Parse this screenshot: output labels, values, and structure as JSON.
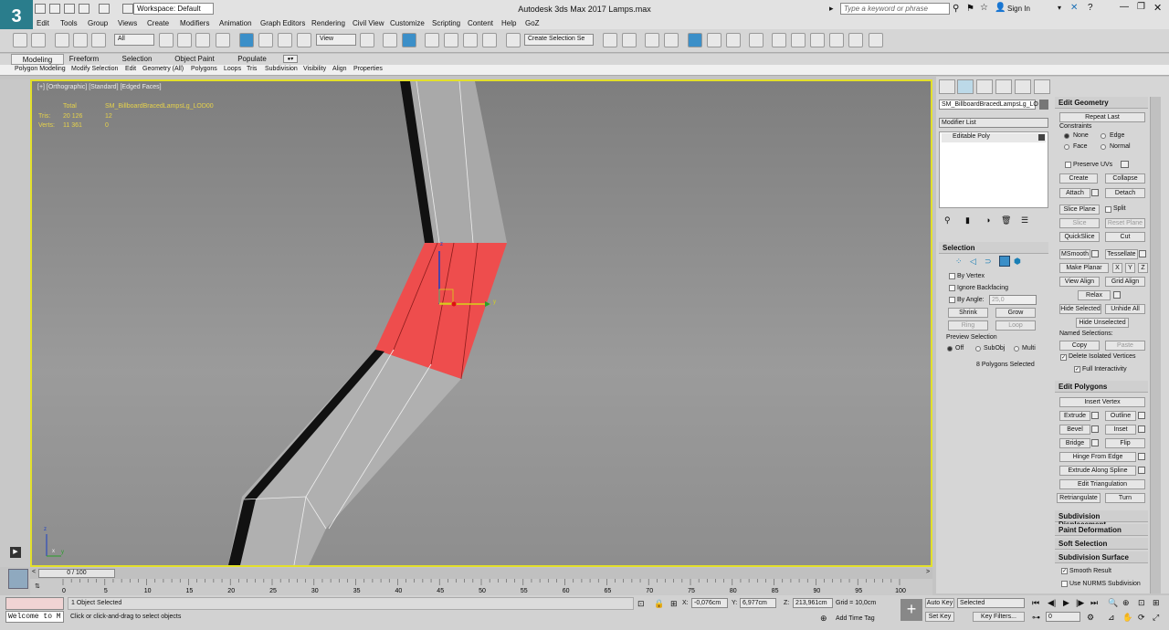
{
  "app": {
    "logo": "3",
    "title": "Autodesk 3ds Max 2017    Lamps.max",
    "workspace": "Workspace: Default",
    "search_placeholder": "Type a keyword or phrase",
    "signin": "Sign In"
  },
  "menu": [
    "Edit",
    "Tools",
    "Group",
    "Views",
    "Create",
    "Modifiers",
    "Animation",
    "Graph Editors",
    "Rendering",
    "Civil View",
    "Customize",
    "Scripting",
    "Content",
    "Help",
    "GoZ"
  ],
  "toolbar": {
    "filter": "All",
    "refcoord": "View",
    "selset": "Create Selection Se"
  },
  "ribbon_tabs": [
    "Modeling",
    "Freeform",
    "Selection",
    "Object Paint",
    "Populate"
  ],
  "ribbon_sub": [
    "Polygon Modeling",
    "Modify Selection",
    "Edit",
    "Geometry (All)",
    "Polygons",
    "Loops",
    "Tris",
    "Subdivision",
    "Visibility",
    "Align",
    "Properties"
  ],
  "viewport": {
    "label": "[+] [Orthographic] [Standard] [Edged Faces]",
    "stats_header_total": "Total",
    "stats_header_obj": "SM_BillboardBracedLampsLg_LOD00",
    "tris_label": "Tris:",
    "tris_total": "20 126",
    "tris_obj": "12",
    "verts_label": "Verts:",
    "verts_total": "11 361",
    "verts_obj": "0",
    "gizmo_z": "z",
    "gizmo_y": "y",
    "axis_x": "x",
    "axis_z": "z",
    "axis_y": "y"
  },
  "panel": {
    "object_name": "SM_BillboardBracedLampsLg_LO",
    "modifier_list": "Modifier List",
    "stack_item": "Editable Poly",
    "selection": {
      "title": "Selection",
      "by_vertex": "By Vertex",
      "ignore_backfacing": "Ignore Backfacing",
      "by_angle": "By Angle:",
      "angle": "25,0",
      "shrink": "Shrink",
      "grow": "Grow",
      "ring": "Ring",
      "loop": "Loop",
      "preview": "Preview Selection",
      "off": "Off",
      "subobj": "SubObj",
      "multi": "Multi",
      "status": "8 Polygons Selected"
    }
  },
  "edit_geometry": {
    "title": "Edit Geometry",
    "repeat_last": "Repeat Last",
    "constraints": "Constraints",
    "none": "None",
    "edge": "Edge",
    "face": "Face",
    "normal": "Normal",
    "preserve_uvs": "Preserve UVs",
    "create": "Create",
    "collapse": "Collapse",
    "attach": "Attach",
    "detach": "Detach",
    "slice_plane": "Slice Plane",
    "split": "Split",
    "slice": "Slice",
    "reset_plane": "Reset Plane",
    "quickslice": "QuickSlice",
    "cut": "Cut",
    "msmooth": "MSmooth",
    "tessellate": "Tessellate",
    "make_planar": "Make Planar",
    "x": "X",
    "y": "Y",
    "z": "Z",
    "view_align": "View Align",
    "grid_align": "Grid Align",
    "relax": "Relax",
    "hide_selected": "Hide Selected",
    "unhide_all": "Unhide All",
    "hide_unselected": "Hide Unselected",
    "named_sel": "Named Selections:",
    "copy": "Copy",
    "paste": "Paste",
    "delete_isolated": "Delete Isolated Vertices",
    "full_interactivity": "Full Interactivity"
  },
  "edit_polygons": {
    "title": "Edit Polygons",
    "insert_vertex": "Insert Vertex",
    "extrude": "Extrude",
    "outline": "Outline",
    "bevel": "Bevel",
    "inset": "Inset",
    "bridge": "Bridge",
    "flip": "Flip",
    "hinge": "Hinge From Edge",
    "extrude_spline": "Extrude Along Spline",
    "edit_tri": "Edit Triangulation",
    "retriangulate": "Retriangulate",
    "turn": "Turn"
  },
  "rollouts": [
    "Subdivision Displacement",
    "Paint Deformation",
    "Soft Selection",
    "Subdivision Surface"
  ],
  "subdiv": {
    "smooth_result": "Smooth Result",
    "use_nurms": "Use NURMS Subdivision"
  },
  "timeline": {
    "frame": "0 / 100",
    "ticks": [
      "0",
      "5",
      "10",
      "15",
      "20",
      "25",
      "30",
      "35",
      "40",
      "45",
      "50",
      "55",
      "60",
      "65",
      "70",
      "75",
      "80",
      "85",
      "90",
      "95",
      "100"
    ]
  },
  "status": {
    "listener": "Welcome to M",
    "objects": "1 Object Selected",
    "prompt": "Click or click-and-drag to select objects",
    "x_label": "X:",
    "x": "-0,076cm",
    "y_label": "Y:",
    "y": "6,977cm",
    "z_label": "Z:",
    "z": "213,961cm",
    "grid": "Grid = 10,0cm",
    "add_time_tag": "Add Time Tag",
    "auto_key": "Auto Key",
    "set_key": "Set Key",
    "selected": "Selected",
    "key_filters": "Key Filters...",
    "frame_field": "0"
  }
}
